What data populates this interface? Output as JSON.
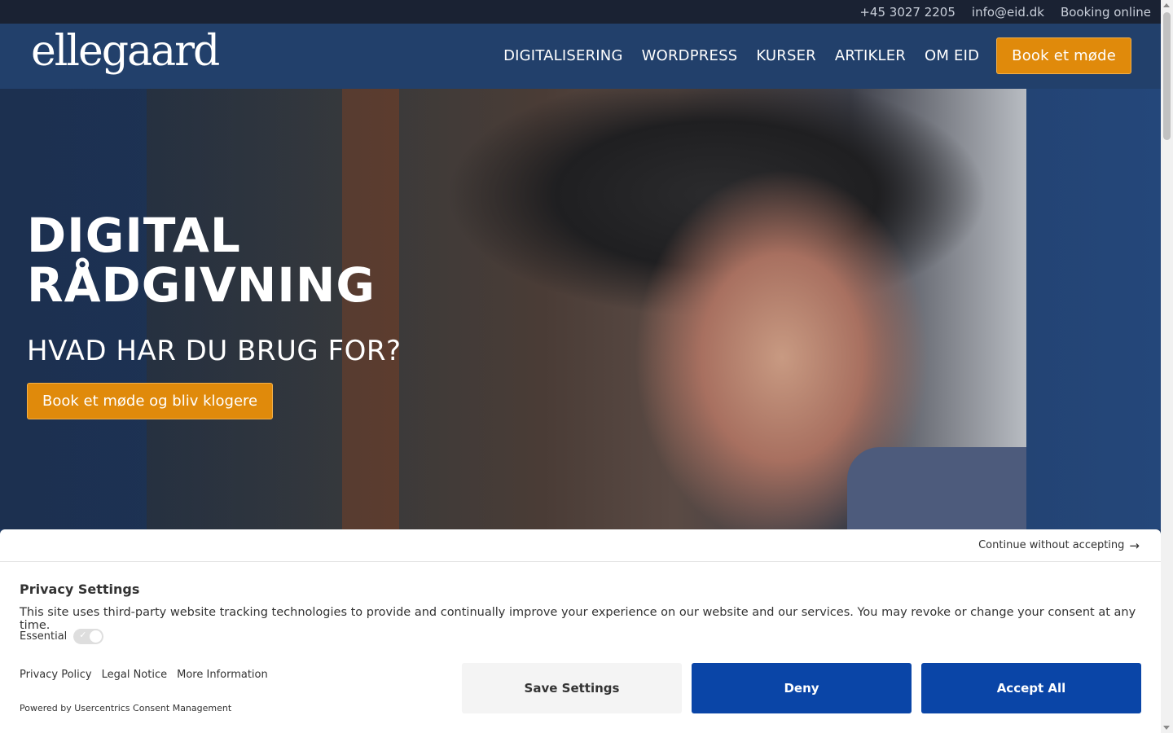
{
  "topbar": {
    "phone": "+45 3027 2205",
    "email": "info@eid.dk",
    "booking": "Booking online"
  },
  "header": {
    "logo": "ellegaard",
    "nav": [
      "DIGITALISERING",
      "WORDPRESS",
      "KURSER",
      "ARTIKLER",
      "OM EID"
    ],
    "cta": "Book et møde"
  },
  "hero": {
    "title_line1": "DIGITAL",
    "title_line2": "RÅDGIVNING",
    "subtitle": "HVAD HAR DU BRUG FOR?",
    "button": "Book et møde og bliv klogere"
  },
  "consent": {
    "continue": "Continue without accepting",
    "title": "Privacy Settings",
    "description": "This site uses third-party website tracking technologies to provide and continually improve your experience on our website and our services. You may revoke or change your consent at any time.",
    "essential_label": "Essential",
    "links": [
      "Privacy Policy",
      "Legal Notice",
      "More Information"
    ],
    "powered": "Powered by Usercentrics Consent Management",
    "save": "Save Settings",
    "deny": "Deny",
    "accept": "Accept All"
  },
  "colors": {
    "accent_orange": "#e08a0b",
    "header_blue": "#22406b",
    "consent_blue": "#0a45a7"
  }
}
